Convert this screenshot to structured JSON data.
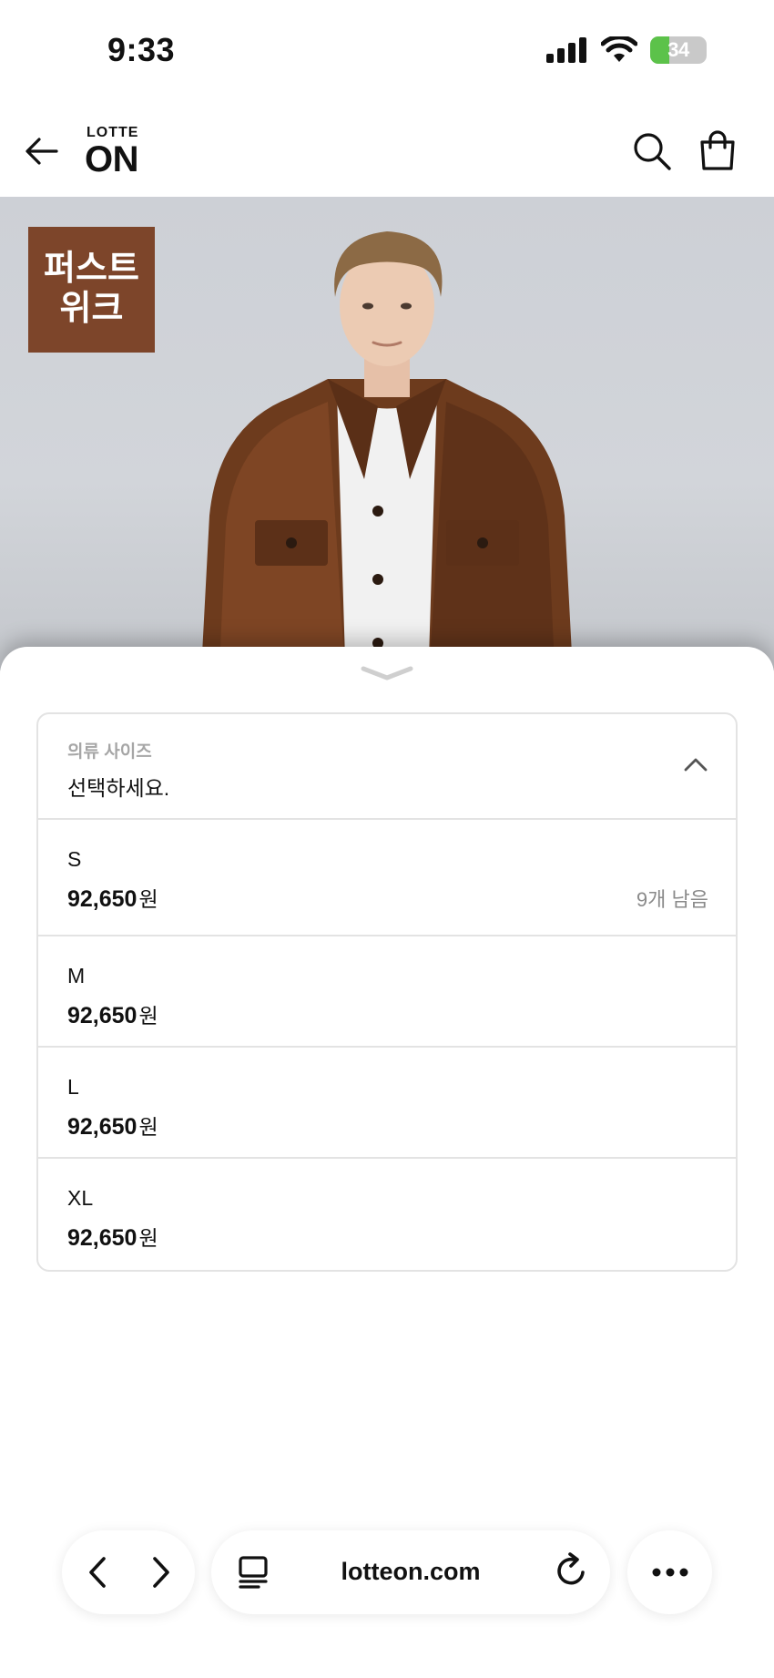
{
  "status_bar": {
    "time": "9:33",
    "battery_level": "34",
    "battery_fraction": 0.34,
    "icons": [
      "signal-icon",
      "wifi-icon",
      "battery-charging-icon"
    ]
  },
  "header": {
    "logo_small": "LOTTE",
    "logo_big": "ON",
    "icons": [
      "back-arrow-icon",
      "search-icon",
      "shopping-bag-icon"
    ]
  },
  "hero": {
    "badge_line1": "퍼스트",
    "badge_line2": "위크",
    "badge_color": "#7d452a"
  },
  "option_sheet": {
    "select_label": "의류 사이즈",
    "select_value": "선택하세요.",
    "options": [
      {
        "size": "S",
        "price": "92,650",
        "unit": "원",
        "stock": "9개 남음"
      },
      {
        "size": "M",
        "price": "92,650",
        "unit": "원",
        "stock": ""
      },
      {
        "size": "L",
        "price": "92,650",
        "unit": "원",
        "stock": ""
      },
      {
        "size": "XL",
        "price": "92,650",
        "unit": "원",
        "stock": ""
      }
    ]
  },
  "browser": {
    "url": "lotteon.com",
    "icons": [
      "nav-back-icon",
      "nav-forward-icon",
      "tabs-icon",
      "reload-icon",
      "more-icon"
    ]
  }
}
